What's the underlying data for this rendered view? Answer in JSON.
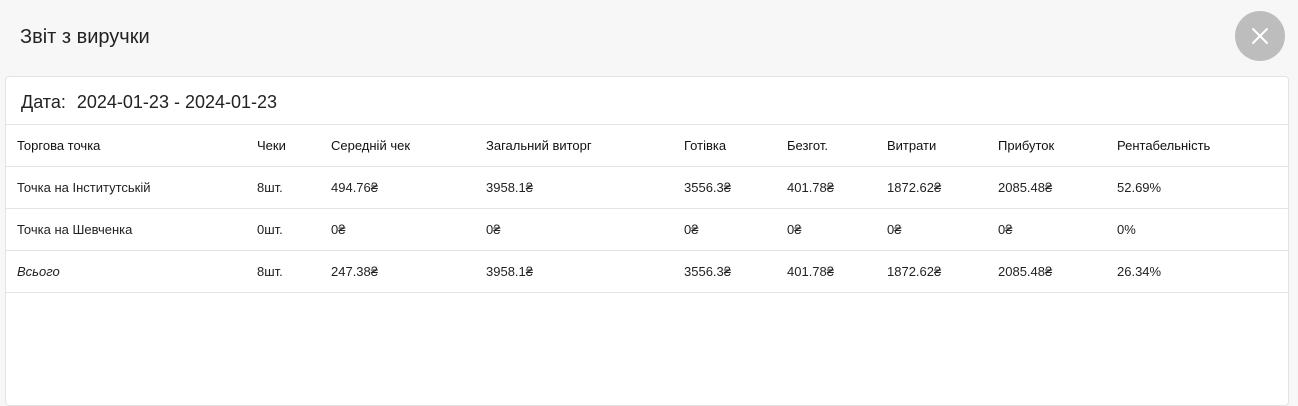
{
  "modal": {
    "title": "Звіт з виручки"
  },
  "date": {
    "label": "Дата:",
    "range": "2024-01-23 - 2024-01-23"
  },
  "table": {
    "headers": [
      "Торгова точка",
      "Чеки",
      "Середній чек",
      "Загальний виторг",
      "Готівка",
      "Безгот.",
      "Витрати",
      "Прибуток",
      "Рентабельність"
    ],
    "rows": [
      [
        "Точка на Інститутській",
        "8шт.",
        "494.76₴",
        "3958.1₴",
        "3556.3₴",
        "401.78₴",
        "1872.62₴",
        "2085.48₴",
        "52.69%"
      ],
      [
        "Точка на Шевченка",
        "0шт.",
        "0₴",
        "0₴",
        "0₴",
        "0₴",
        "0₴",
        "0₴",
        "0%"
      ]
    ],
    "total": [
      "Всього",
      "8шт.",
      "247.38₴",
      "3958.1₴",
      "3556.3₴",
      "401.78₴",
      "1872.62₴",
      "2085.48₴",
      "26.34%"
    ]
  },
  "icons": {
    "close": "close-icon"
  },
  "colors": {
    "close_button_bg": "#bdbdbd",
    "page_bg": "#f7f7f7",
    "card_bg": "#ffffff",
    "divider": "#e3e3e3"
  }
}
